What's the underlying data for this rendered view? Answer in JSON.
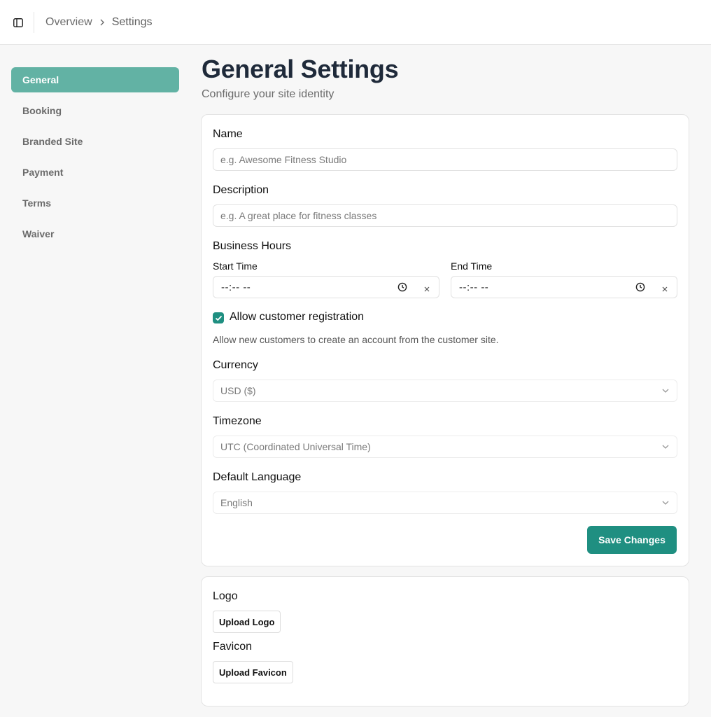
{
  "header": {
    "toggle_icon": "sidebar-panel-icon",
    "breadcrumb": {
      "parent": "Overview",
      "separator_icon": "chevron-right-icon",
      "current": "Settings"
    }
  },
  "sidebar": {
    "items": [
      {
        "label": "General",
        "active": true
      },
      {
        "label": "Booking",
        "active": false
      },
      {
        "label": "Branded Site",
        "active": false
      },
      {
        "label": "Payment",
        "active": false
      },
      {
        "label": "Terms",
        "active": false
      },
      {
        "label": "Waiver",
        "active": false
      }
    ]
  },
  "page": {
    "title": "General Settings",
    "subtitle": "Configure your site identity"
  },
  "form": {
    "name": {
      "label": "Name",
      "value": "",
      "placeholder": "e.g. Awesome Fitness Studio"
    },
    "description": {
      "label": "Description",
      "value": "",
      "placeholder": "e.g. A great place for fitness classes"
    },
    "business_hours": {
      "label": "Business Hours",
      "start": {
        "label": "Start Time",
        "value": "--:-- --"
      },
      "end": {
        "label": "End Time",
        "value": "--:-- --"
      }
    },
    "allow_registration": {
      "label": "Allow customer registration",
      "checked": true,
      "help": "Allow new customers to create an account from the customer site."
    },
    "currency": {
      "label": "Currency",
      "value": "USD ($)"
    },
    "timezone": {
      "label": "Timezone",
      "value": "UTC (Coordinated Universal Time)"
    },
    "language": {
      "label": "Default Language",
      "value": "English"
    },
    "save_label": "Save Changes"
  },
  "assets": {
    "logo": {
      "label": "Logo",
      "button": "Upload Logo"
    },
    "favicon": {
      "label": "Favicon",
      "button": "Upload Favicon"
    }
  },
  "colors": {
    "accent": "#1f8f81",
    "active_nav": "#62b2a4",
    "title": "#1f2a3a",
    "background": "#f7f7f7"
  }
}
